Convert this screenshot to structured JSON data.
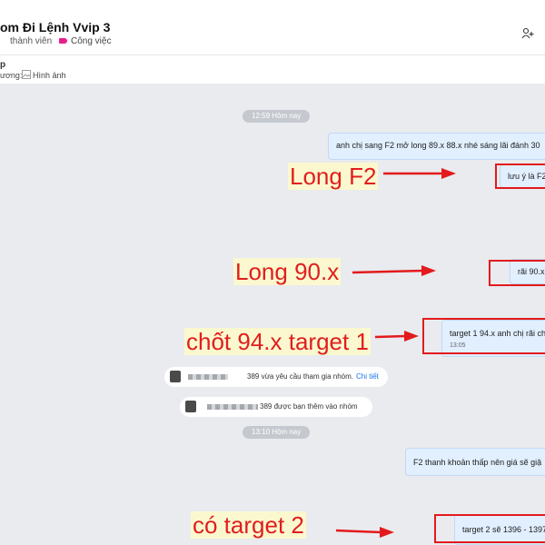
{
  "header": {
    "title": "om Đi Lệnh Vvip 3",
    "members_label": "thành viên",
    "tag_label": "Công việc",
    "tag_color": "#e91e8c",
    "subheader_letter": "p",
    "subheader_prefix": "ương:",
    "image_label": "Hình ảnh"
  },
  "chat": {
    "time1": "12:59 Hôm nay",
    "msg1": "anh chị sang F2 mở long 89.x 88.x nhé sáng lãi đánh 30",
    "msg2": "lưu ý là F2",
    "msg3": "rãi 90.x",
    "msg4": "target 1 94.x anh chị rãi ch",
    "msg4_time": "13:05",
    "sys1_text": "389 vừa yêu cầu tham gia nhóm.",
    "sys1_link": "Chi tiết",
    "sys2_text": "389 được bạn thêm vào nhóm",
    "time2": "13:10 Hôm nay",
    "msg5": "F2 thanh khoản thấp nên giá sẽ giậ",
    "msg6": "target 2 sẽ 1396 - 1397"
  },
  "annotations": {
    "note1": "Long F2",
    "note2": "Long 90.x",
    "note3": "chốt 94.x target 1",
    "note4": "có target 2",
    "color": "#e31a1c"
  },
  "colors": {
    "bubble_bg": "#e1efff",
    "chat_bg": "#e9ebef",
    "link": "#1a73e8"
  }
}
